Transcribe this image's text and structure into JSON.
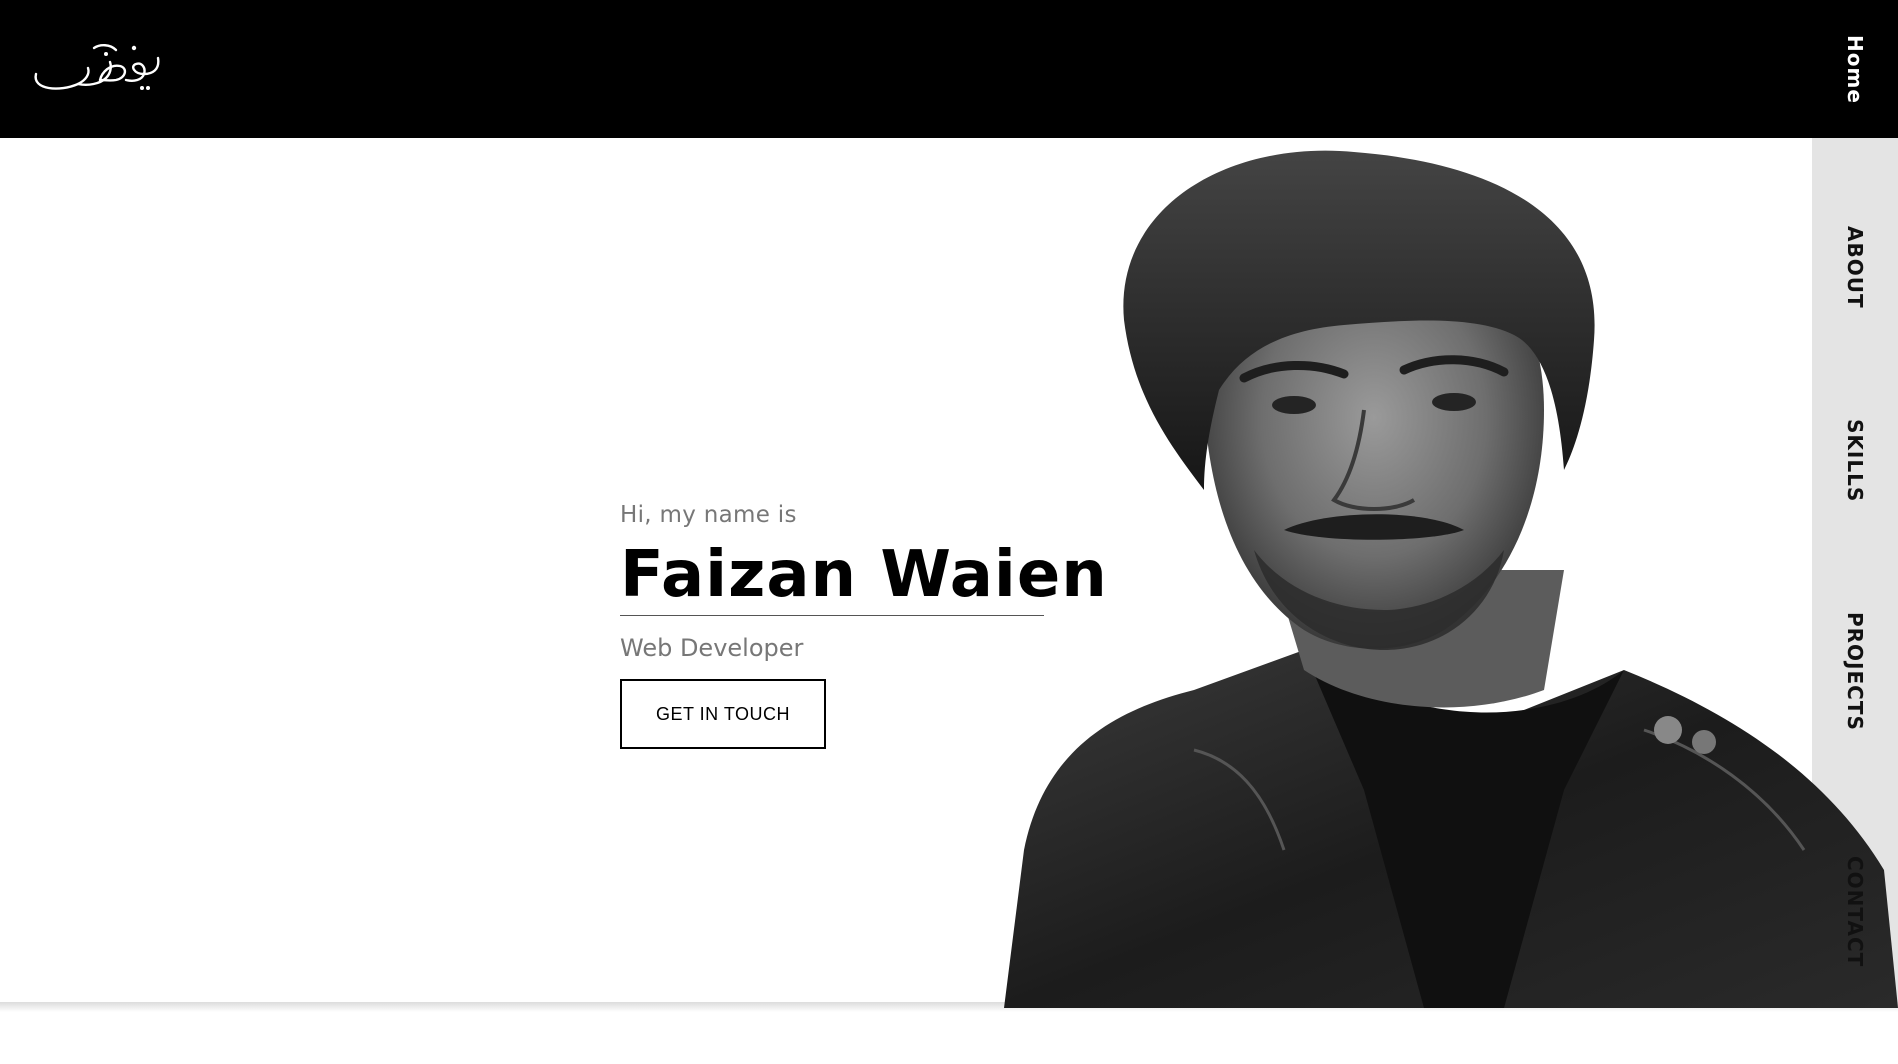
{
  "header": {
    "logo_text": "فیضان"
  },
  "nav": {
    "items": [
      {
        "label": "Home"
      },
      {
        "label": "ABOUT"
      },
      {
        "label": "SKILLS"
      },
      {
        "label": "PROJECTS"
      },
      {
        "label": "CONTACT"
      }
    ]
  },
  "hero": {
    "greeting": "Hi, my name is",
    "name": "Faizan Waien",
    "role": "Web Developer",
    "cta_label": "GET IN TOUCH"
  },
  "colors": {
    "header_bg": "#000000",
    "sidebar_bg": "#e4e4e4",
    "text_muted": "#777777"
  }
}
